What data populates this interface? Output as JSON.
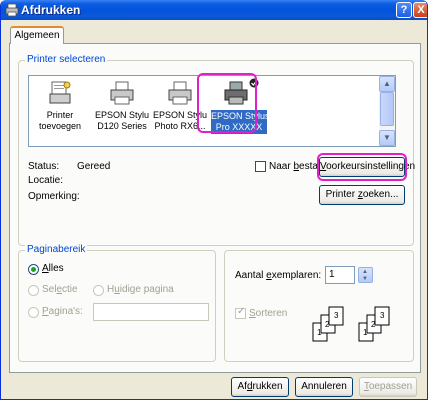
{
  "window": {
    "title": "Afdrukken",
    "help_glyph": "?",
    "close_glyph": "X"
  },
  "tabs": [
    {
      "label": "Algemeen",
      "active": true
    }
  ],
  "printer_group": {
    "legend": "Printer selecteren",
    "printers": [
      {
        "line1": "Printer",
        "line2": "toevoegen"
      },
      {
        "line1": "EPSON Stylus",
        "line2": "D120 Series"
      },
      {
        "line1": "EPSON Stylu",
        "line2": "Photo RX6..."
      },
      {
        "line1": "EPSON Stylus",
        "line2": "Pro  XXXXX",
        "selected": true
      }
    ],
    "scroll_up": "▲",
    "scroll_down": "▼",
    "status_label": "Status:",
    "status_value": "Gereed",
    "location_label": "Locatie:",
    "location_value": "",
    "comment_label": "Opmerking:",
    "comment_value": "",
    "to_file": {
      "pre": "Naar ",
      "acc": "b",
      "post": "estand",
      "checked": false
    },
    "preferences_button": {
      "acc": "V",
      "post": "oorkeursinstellingen"
    },
    "find_printer_button": {
      "pre": "Printer ",
      "acc": "z",
      "post": "oeken..."
    }
  },
  "page_range": {
    "legend": "Paginabereik",
    "all": {
      "acc": "A",
      "post": "lles",
      "selected": true
    },
    "selection": {
      "pre": "Sel",
      "acc": "e",
      "post": "ctie"
    },
    "current_page": {
      "pre": "H",
      "acc": "u",
      "post": "idige pagina"
    },
    "pages": {
      "acc": "P",
      "post": "agina's:",
      "value": ""
    }
  },
  "copies": {
    "label_pre": "Aantal ",
    "label_acc": "e",
    "label_post": "xemplaren:",
    "value": "1",
    "collate": {
      "acc": "S",
      "post": "orteren",
      "checked": true
    },
    "spin_up": "▲",
    "spin_down": "▼"
  },
  "footer": {
    "print_button": {
      "pre": "Af",
      "acc": "d",
      "post": "rukken"
    },
    "cancel_button": "Annuleren",
    "apply_button": {
      "acc": "T",
      "post": "oepassen"
    }
  },
  "colors": {
    "title_blue": "#0a5de0",
    "highlight_magenta": "#e020c8",
    "selection_blue": "#316ac5",
    "group_legend": "#0046d5"
  }
}
